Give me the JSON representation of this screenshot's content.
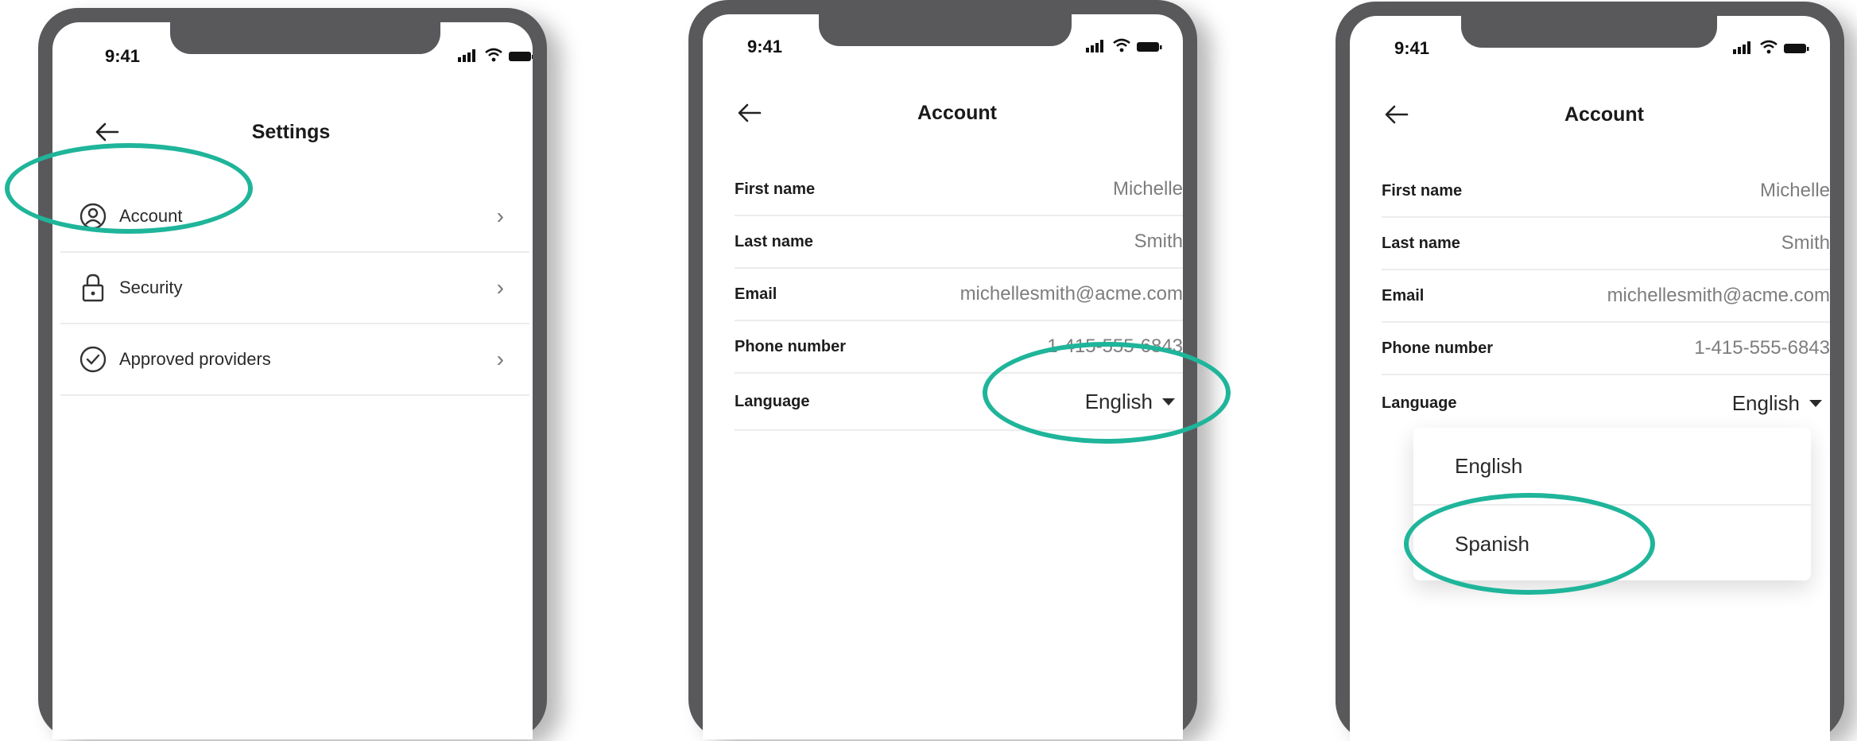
{
  "status_bar": {
    "time": "9:41"
  },
  "screens": [
    {
      "title": "Settings",
      "items": [
        {
          "label": "Account"
        },
        {
          "label": "Security"
        },
        {
          "label": "Approved providers"
        }
      ]
    },
    {
      "title": "Account",
      "fields": [
        {
          "label": "First name",
          "value": "Michelle"
        },
        {
          "label": "Last name",
          "value": "Smith"
        },
        {
          "label": "Email",
          "value": "michellesmith@acme.com"
        },
        {
          "label": "Phone number",
          "value": "1-415-555-6843"
        },
        {
          "label": "Language",
          "value": "English"
        }
      ]
    },
    {
      "title": "Account",
      "fields": [
        {
          "label": "First name",
          "value": "Michelle"
        },
        {
          "label": "Last name",
          "value": "Smith"
        },
        {
          "label": "Email",
          "value": "michellesmith@acme.com"
        },
        {
          "label": "Phone number",
          "value": "1-415-555-6843"
        },
        {
          "label": "Language",
          "value": "English"
        }
      ],
      "language_options": [
        "English",
        "Spanish"
      ]
    }
  ],
  "colors": {
    "highlight_ring": "#1fb59a",
    "phone_frame": "#59595c"
  }
}
